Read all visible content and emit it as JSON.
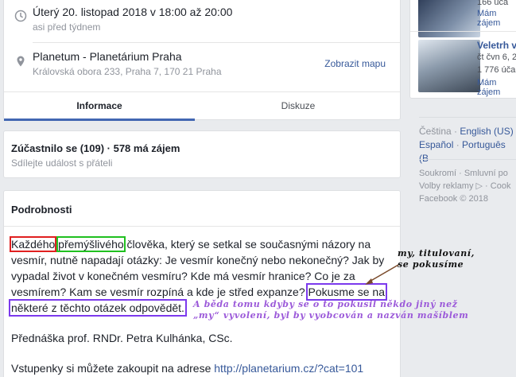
{
  "event": {
    "date_main": "Úterý 20. listopad 2018 v 18:00 až 20:00",
    "date_sub": "asi před týdnem",
    "place_main": "Planetum - Planetárium Praha",
    "place_sub": "Královská obora 233, Praha 7, 170 21 Praha",
    "map_link": "Zobrazit mapu",
    "tabs": [
      {
        "label": "Informace",
        "active": true
      },
      {
        "label": "Diskuze",
        "active": false
      }
    ]
  },
  "attendance": {
    "title": "Zúčastnilo se (109) · 578 má zájem",
    "subtitle": "Sdílejte událost s přáteli"
  },
  "details": {
    "title": "Podrobnosti",
    "word_red": "Každého",
    "word_green": "přemýšlivého",
    "text_a": " člověka, který se setkal se současnými názory na vesmír, nutně napadají otázky: Je vesmír konečný nebo nekonečný? Jak by vypadal život v konečném vesmíru? Kde má vesmír hranice? Co je za vesmírem? Kam se vesmír rozpíná a kde je střed expanze? ",
    "box_purple_1": "Pokusme se na",
    "box_purple_2": "některé z těchto otázek odpovědět.",
    "lecturer": "Přednáška prof. RNDr. Petra Kulhánka, CSc.",
    "tickets_text": "Vstupenky si můžete zakoupit na adrese ",
    "tickets_link": "http://planetarium.cz/?cat=101"
  },
  "annotations": {
    "note_1_line1": "my, titulovaní,",
    "note_1_line2": "se pokusíme",
    "note_2_line1": "A běda tomu kdyby se o to pokusil někdo jiný než",
    "note_2_line2": "„my“ vyvolení, byl by vyobcován a nazván mašíblem"
  },
  "sidebar": {
    "item1_line1": "166 úča",
    "item1_link": "Mám zájem",
    "item2_title": "Veletrh v",
    "item2_line1": "čt čvn 6, 2",
    "item2_line2": "1 776 úča",
    "item2_link": "Mám zájem",
    "languages_line1_a": "Čeština",
    "languages_line1_b": "English (US)",
    "languages_line2_a": "Español",
    "languages_line2_b": "Português (B",
    "footer_1": "Soukromí · Smluvní po",
    "footer_2": "Volby reklamy ▷ · Cook",
    "footer_3": "Facebook © 2018"
  },
  "colors": {
    "accent": "#4267b2",
    "link": "#365899",
    "box_red": "#e02020",
    "box_green": "#20c020",
    "box_purple": "#7c3aed",
    "annot_purple": "#9b59d9"
  }
}
